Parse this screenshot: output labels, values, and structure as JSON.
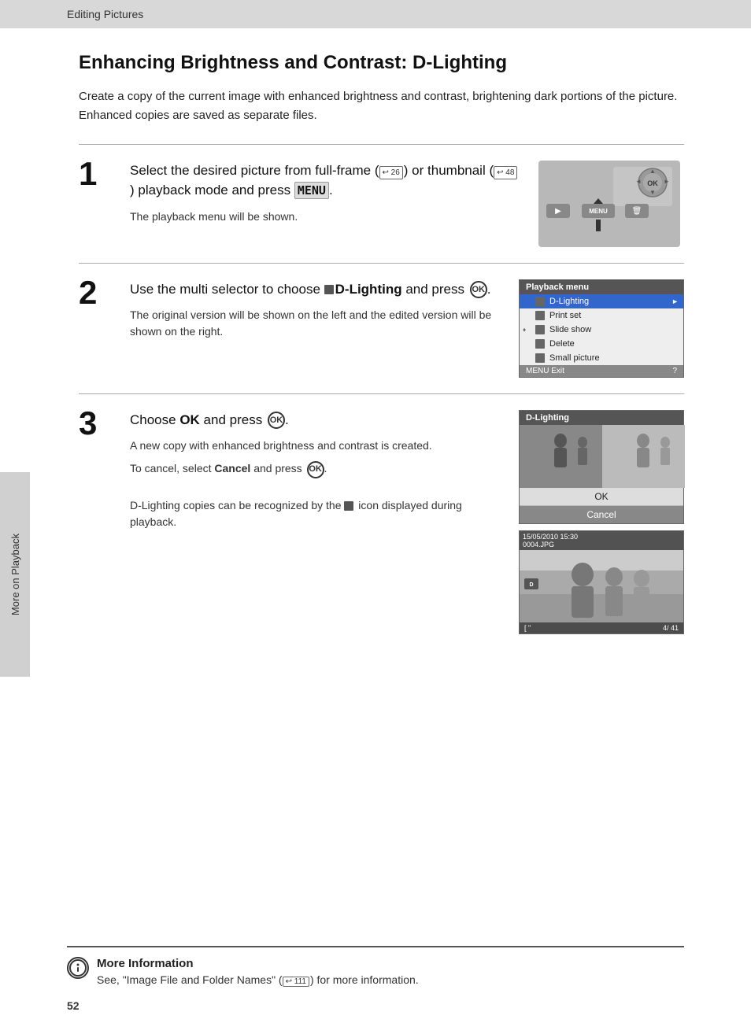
{
  "header": {
    "label": "Editing Pictures"
  },
  "sidebar": {
    "text": "More on Playback"
  },
  "page_number": "52",
  "page_title": "Enhancing Brightness and Contrast: D-Lighting",
  "intro": "Create a copy of the current image with enhanced brightness and contrast, brightening dark portions of the picture. Enhanced copies are saved as separate files.",
  "steps": [
    {
      "number": "1",
      "instruction": "Select the desired picture from full-frame (  26) or thumbnail (  48) playback mode and press MENU.",
      "note": "The playback menu will be shown."
    },
    {
      "number": "2",
      "instruction": "Use the multi selector to choose D-Lighting and press OK.",
      "note": "The original version will be shown on the left and the edited version will be shown on the right."
    },
    {
      "number": "3",
      "instruction": "Choose OK and press OK.",
      "note1": "A new copy with enhanced brightness and contrast is created.",
      "note2": "To cancel, select Cancel and press OK.",
      "note3": "D-Lighting copies can be recognized by the icon displayed during playback."
    }
  ],
  "playback_menu": {
    "title": "Playback menu",
    "items": [
      {
        "label": "D-Lighting",
        "selected": true,
        "has_arrow": true
      },
      {
        "label": "Print set",
        "selected": false
      },
      {
        "label": "Slide show",
        "selected": false
      },
      {
        "label": "Delete",
        "selected": false
      },
      {
        "label": "Small picture",
        "selected": false
      }
    ],
    "footer": "MENU Exit",
    "footer_right": "?"
  },
  "dlighting_ui": {
    "title": "D-Lighting",
    "ok_label": "OK",
    "cancel_label": "Cancel"
  },
  "playback_image": {
    "timestamp": "15/05/2010 15:30",
    "filename": "0004.JPG",
    "counter": "4/  41"
  },
  "more_info": {
    "title": "More Information",
    "text": "See, \"Image File and Folder Names\" (  111) for more information."
  }
}
